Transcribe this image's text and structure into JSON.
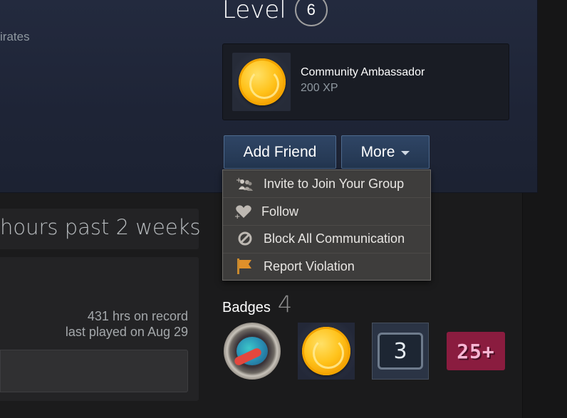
{
  "profile": {
    "location_fragment": "irates",
    "level_label": "Level",
    "level_value": "6"
  },
  "featured_badge": {
    "name": "Community Ambassador",
    "xp": "200 XP",
    "icon": "gold-coin-laurel-icon"
  },
  "actions": {
    "add_friend_label": "Add Friend",
    "more_label": "More"
  },
  "more_menu": {
    "items": [
      {
        "label": "Invite to Join Your Group",
        "icon": "invite-group-icon"
      },
      {
        "label": "Follow",
        "icon": "follow-heart-icon"
      },
      {
        "label": "Block All Communication",
        "icon": "block-icon"
      },
      {
        "label": "Report Violation",
        "icon": "flag-icon"
      }
    ]
  },
  "recent_activity": {
    "title_fragment": "hours past 2 weeks",
    "game": {
      "hours_on_record": "431 hrs on record",
      "last_played": "last played on Aug 29"
    }
  },
  "badges": {
    "label": "Badges",
    "count": "4",
    "items": [
      {
        "icon": "rocket-porthole-badge-icon"
      },
      {
        "icon": "gold-coin-laurel-icon"
      },
      {
        "icon": "number-badge-icon",
        "text": "3"
      },
      {
        "icon": "pixel-25-plus-badge-icon",
        "text": "25+"
      }
    ]
  },
  "colors": {
    "header_bg": "#232a3e",
    "page_bg": "#1b1b1c",
    "button_bg": "#2f4565",
    "menu_bg": "#3e3d3c",
    "muted_text": "#8f98a0",
    "flag_orange": "#e0902a"
  }
}
